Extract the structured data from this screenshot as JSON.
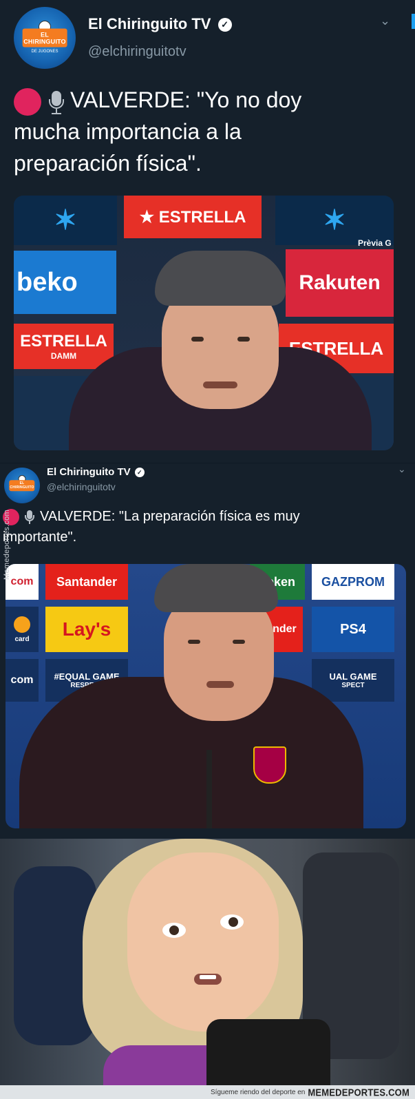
{
  "tweet1": {
    "account_name": "El Chiringuito TV",
    "handle": "@elchiringuitotv",
    "avatar_text": "EL CHIRINGUITO",
    "avatar_subtext": "DE JUGONES",
    "text": "VALVERDE: \"Yo no doy mucha importancia a la preparación física\".",
    "media_sponsors": [
      "Prèvia G",
      "Rakuten",
      "ESTRELLA",
      "DAMM",
      "ESTRELLA",
      "beko"
    ]
  },
  "tweet2": {
    "account_name": "El Chiringuito TV",
    "handle": "@elchiringuitotv",
    "text": "VALVERDE: \"La preparación física es muy importante\".",
    "media_sponsors": [
      "Santander",
      "heken",
      "GAZPROM",
      "Lay's",
      "ander",
      "PS4",
      "#EQUAL GAME",
      "RESPECT",
      "UAL GAME",
      "SPECT",
      "com",
      "card",
      "com"
    ]
  },
  "watermark": "Memedeportes.com",
  "footer": {
    "slogan": "Sígueme riendo del deporte en",
    "site": "MEMEDEPORTES.COM"
  },
  "colors": {
    "background": "#15202b",
    "secondary_text": "#8899a6",
    "record_red": "#e0245e",
    "chiringuito_orange": "#f47c20"
  },
  "icons": [
    "verified-icon",
    "chevron-down-icon",
    "red-circle-icon",
    "microphone-icon"
  ]
}
